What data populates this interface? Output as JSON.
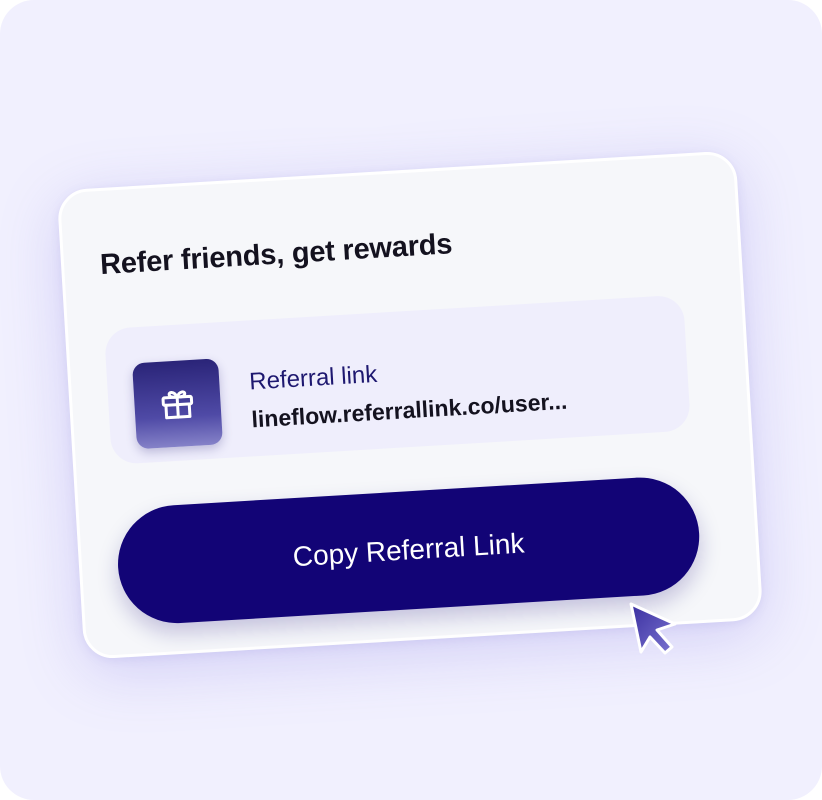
{
  "card": {
    "title": "Refer friends, get rewards",
    "referral": {
      "label": "Referral link",
      "link": "lineflow.referrallink.co/user...",
      "icon": "gift-icon"
    },
    "copy_button_label": "Copy Referral Link"
  },
  "pointer": {
    "icon": "cursor-arrow-icon"
  },
  "colors": {
    "background": "#f1f0fe",
    "card": "#f6f7fa",
    "link_box": "#efeefc",
    "primary": "#120476",
    "label_text": "#1e1870",
    "title_text": "#14121f"
  }
}
